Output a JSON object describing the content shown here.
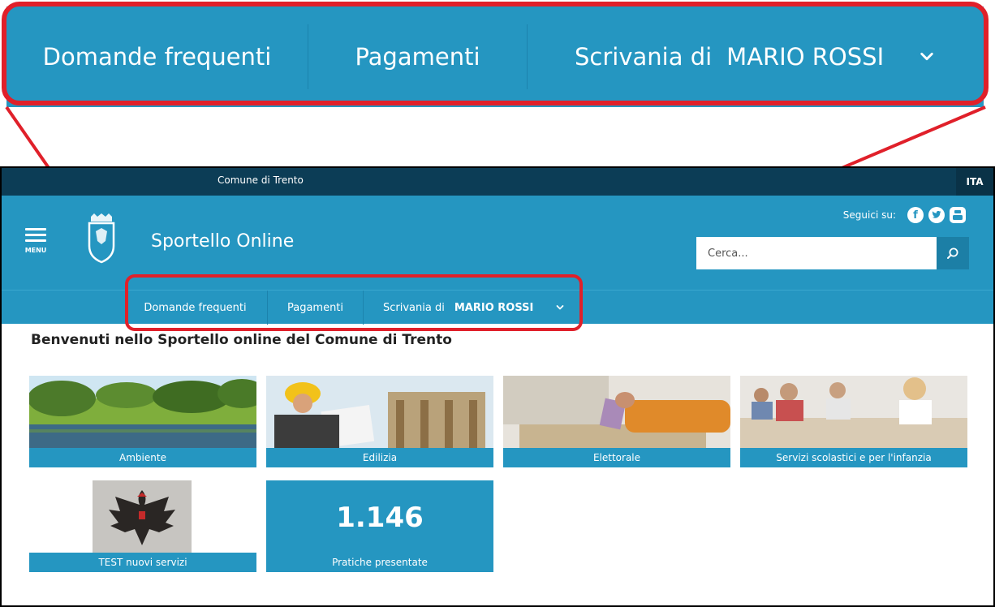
{
  "zoom": {
    "faq_label": "Domande frequenti",
    "payments_label": "Pagamenti",
    "desk_prefix": "Scrivania di",
    "user_name": "MARIO ROSSI"
  },
  "topbar": {
    "org_name": "Comune di Trento",
    "language": "ITA"
  },
  "header": {
    "menu_label": "MENU",
    "site_title": "Sportello Online",
    "follow_label": "Seguici su:",
    "social_icons": [
      "facebook-icon",
      "twitter-icon",
      "youtube-icon"
    ],
    "search_placeholder": "Cerca..."
  },
  "nav": {
    "faq_label": "Domande frequenti",
    "payments_label": "Pagamenti",
    "desk_prefix": "Scrivania di",
    "user_name": "MARIO ROSSI"
  },
  "main": {
    "welcome": "Benvenuti nello Sportello online del Comune di Trento",
    "tiles": [
      {
        "label": "Ambiente"
      },
      {
        "label": "Edilizia"
      },
      {
        "label": "Elettorale"
      },
      {
        "label": "Servizi scolastici e per l'infanzia"
      },
      {
        "label": "TEST nuovi servizi"
      }
    ],
    "stat": {
      "value": "1.146",
      "label": "Pratiche presentate"
    }
  },
  "colors": {
    "brand_blue": "#2596c1",
    "top_bar": "#0c3d56",
    "highlight_red": "#e0202a"
  }
}
